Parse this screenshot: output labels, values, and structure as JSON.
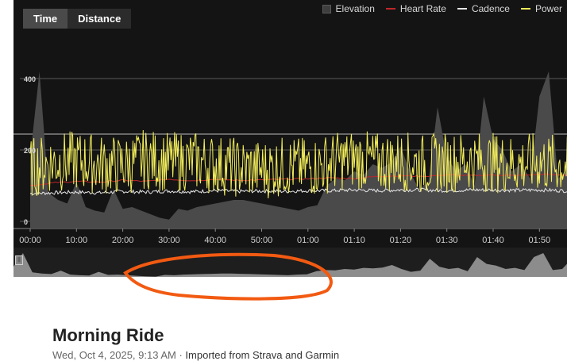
{
  "tabs": [
    {
      "label": "Time",
      "active": true
    },
    {
      "label": "Distance",
      "active": false
    }
  ],
  "legend": [
    {
      "label": "Elevation",
      "color": "#3e3e3e",
      "kind": "area"
    },
    {
      "label": "Heart Rate",
      "color": "#c0262b",
      "kind": "line"
    },
    {
      "label": "Cadence",
      "color": "#e6e6e6",
      "kind": "line"
    },
    {
      "label": "Power",
      "color": "#f3ee5a",
      "kind": "line"
    }
  ],
  "chart_data": {
    "type": "line",
    "y_ticks": [
      "400",
      "200",
      "0"
    ],
    "ylim": [
      0,
      420
    ],
    "x_ticks": [
      "00:00",
      "10:00",
      "20:00",
      "30:00",
      "40:00",
      "50:00",
      "01:00",
      "01:10",
      "01:20",
      "01:30",
      "01:40",
      "01:50"
    ],
    "x_range_minutes": [
      0,
      117
    ],
    "series": [
      {
        "name": "Elevation",
        "color": "#4a4a4a",
        "x": [
          0,
          2,
          4,
          6,
          8,
          10,
          12,
          14,
          16,
          18,
          20,
          22,
          24,
          26,
          28,
          30,
          32,
          34,
          36,
          38,
          40,
          42,
          44,
          46,
          48,
          50,
          52,
          54,
          56,
          58,
          60,
          62,
          64,
          66,
          68,
          70,
          72,
          74,
          76,
          78,
          80,
          82,
          84,
          86,
          88,
          90,
          92,
          94,
          96,
          98,
          100,
          102,
          104,
          106,
          108,
          110,
          112,
          114,
          116,
          117
        ],
        "values": [
          180,
          420,
          80,
          60,
          50,
          110,
          40,
          30,
          25,
          90,
          35,
          40,
          30,
          20,
          10,
          5,
          35,
          30,
          40,
          45,
          50,
          55,
          60,
          60,
          55,
          50,
          45,
          40,
          35,
          30,
          40,
          45,
          100,
          120,
          115,
          140,
          130,
          160,
          150,
          165,
          210,
          140,
          90,
          110,
          320,
          180,
          140,
          160,
          100,
          350,
          230,
          200,
          140,
          160,
          120,
          350,
          420,
          120,
          140,
          230
        ]
      },
      {
        "name": "Heart Rate",
        "color": "#c0262b",
        "x": [
          0,
          5,
          10,
          15,
          20,
          25,
          30,
          35,
          40,
          45,
          50,
          55,
          60,
          65,
          70,
          75,
          80,
          85,
          90,
          95,
          100,
          105,
          110,
          115,
          117
        ],
        "values": [
          100,
          108,
          112,
          110,
          115,
          112,
          118,
          114,
          118,
          115,
          116,
          118,
          119,
          122,
          120,
          126,
          128,
          126,
          130,
          128,
          130,
          128,
          132,
          130,
          128
        ]
      },
      {
        "name": "Cadence",
        "color": "#e6e6e6",
        "x": [
          0,
          5,
          10,
          15,
          20,
          25,
          30,
          35,
          40,
          45,
          50,
          55,
          60,
          65,
          70,
          75,
          80,
          85,
          90,
          95,
          100,
          105,
          110,
          115,
          117
        ],
        "values": [
          78,
          80,
          82,
          80,
          84,
          82,
          85,
          83,
          86,
          84,
          85,
          84,
          86,
          86,
          88,
          86,
          88,
          88,
          86,
          88,
          88,
          87,
          88,
          86,
          84
        ]
      },
      {
        "name": "Power",
        "color": "#f3ee5a",
        "x": [
          0,
          5,
          10,
          15,
          20,
          25,
          30,
          35,
          40,
          45,
          50,
          55,
          60,
          65,
          70,
          75,
          80,
          85,
          90,
          95,
          100,
          105,
          110,
          115,
          117
        ],
        "values": [
          150,
          165,
          170,
          160,
          155,
          175,
          165,
          170,
          160,
          150,
          145,
          155,
          150,
          165,
          175,
          165,
          170,
          160,
          165,
          170,
          165,
          160,
          165,
          158,
          150
        ]
      }
    ]
  },
  "activity": {
    "title": "Morning Ride",
    "date": "Wed, Oct 4, 2025, 9:13 AM",
    "separator": " · ",
    "import_text": "Imported from Strava and Garmin"
  }
}
